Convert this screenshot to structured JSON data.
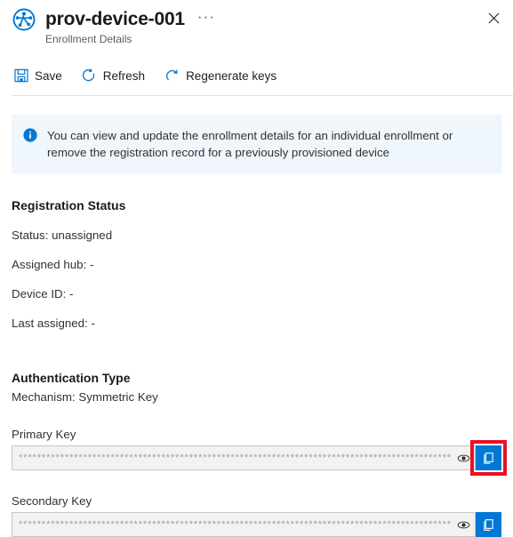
{
  "header": {
    "icon": "dps-device-provisioning-icon",
    "title": "prov-device-001",
    "subtitle": "Enrollment Details",
    "ellipsis": "···",
    "close_label": "Close"
  },
  "toolbar": {
    "buttons": [
      {
        "label": "Save",
        "icon": "save-icon"
      },
      {
        "label": "Refresh",
        "icon": "refresh-icon"
      },
      {
        "label": "Regenerate keys",
        "icon": "regenerate-icon"
      }
    ]
  },
  "banner": {
    "icon": "info-icon",
    "text": "You can view and update the enrollment details for an individual enrollment or remove the registration record for a previously provisioned device"
  },
  "registration": {
    "heading": "Registration Status",
    "rows": [
      "Status: unassigned",
      "Assigned hub: -",
      "Device ID: -",
      "Last assigned: -"
    ]
  },
  "authentication": {
    "heading": "Authentication Type",
    "mechanism": "Mechanism: Symmetric Key",
    "primary_key": {
      "label": "Primary Key",
      "value": "***********************************************************************************************",
      "reveal_label": "Show value",
      "copy_label": "Copy to clipboard",
      "highlighted": true
    },
    "secondary_key": {
      "label": "Secondary Key",
      "value": "***********************************************************************************************",
      "reveal_label": "Show value",
      "copy_label": "Copy to clipboard",
      "highlighted": false
    }
  },
  "colors": {
    "accent": "#0078d4",
    "banner_bg": "#eff6fc",
    "highlight": "#e81123",
    "field_bg": "#f3f2f1",
    "field_border": "#c8c6c4"
  }
}
